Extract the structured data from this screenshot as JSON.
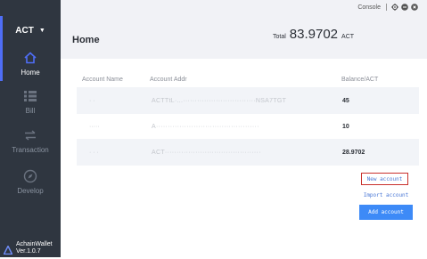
{
  "sidebar": {
    "coin": "ACT",
    "items": [
      {
        "label": "Home",
        "icon": "home-icon"
      },
      {
        "label": "Bill",
        "icon": "list-icon"
      },
      {
        "label": "Transaction",
        "icon": "transfer-icon"
      },
      {
        "label": "Develop",
        "icon": "compass-icon"
      }
    ],
    "brand_name": "AchainWallet",
    "version": "Ver.1.0.7"
  },
  "topbar": {
    "console_label": "Console",
    "icons": [
      "settings-icon",
      "minimize-icon",
      "close-icon"
    ]
  },
  "header": {
    "title": "Home",
    "total_label": "Total",
    "total_value": "83.9702",
    "total_unit": "ACT"
  },
  "table": {
    "columns": [
      "Account Name",
      "Account Addr",
      "Balance/ACT"
    ],
    "rows": [
      {
        "name": "· ·",
        "addr": "ACTTtL·...·······························NSA7TGT",
        "balance": "45"
      },
      {
        "name": "·····",
        "addr": "A············································",
        "balance": "10"
      },
      {
        "name": "· · ·",
        "addr": "ACT·········································",
        "balance": "28.9702"
      }
    ]
  },
  "actions": {
    "new_account": "New account",
    "import_account": "Import account",
    "add_account": "Add account"
  },
  "colors": {
    "sidebar_bg": "#2f3640",
    "accent": "#4f6ef7",
    "primary_button": "#3d8af7",
    "highlight_border": "#c9302c"
  }
}
